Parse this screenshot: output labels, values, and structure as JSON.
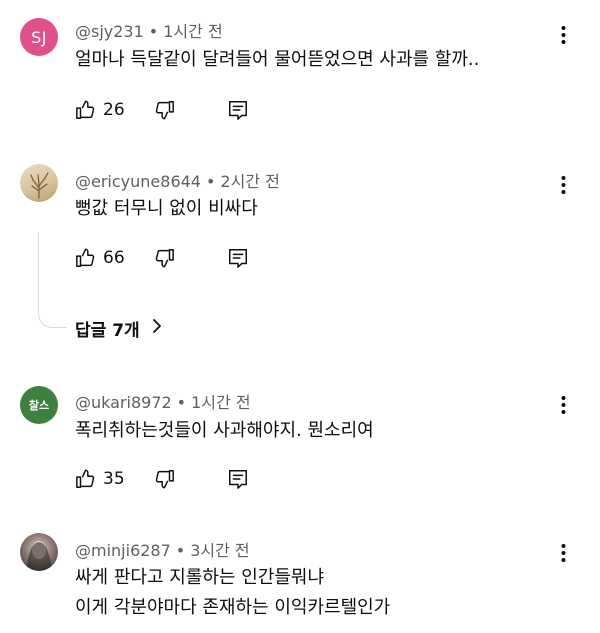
{
  "comments": [
    {
      "avatar_text": "SJ",
      "username": "@sjy231",
      "time": "1시간 전",
      "lines": [
        "얼마나 득달같이 달려들어 물어뜯었으면 사과를 할까.."
      ],
      "likes": "26"
    },
    {
      "avatar_text": "",
      "username": "@ericyune8644",
      "time": "2시간 전",
      "lines": [
        "뻥값 터무니 없이 비싸다"
      ],
      "likes": "66",
      "replies_label": "답글 7개"
    },
    {
      "avatar_text": "찰스",
      "username": "@ukari8972",
      "time": "1시간 전",
      "lines": [
        "폭리취하는것들이 사과해야지. 뭔소리여"
      ],
      "likes": "35"
    },
    {
      "avatar_text": "",
      "username": "@minji6287",
      "time": "3시간 전",
      "lines": [
        "싸게 판다고 지롤하는 인간들뭐냐",
        "이게 각분야마다 존재하는 이익카르텔인가"
      ]
    }
  ],
  "separator": "•",
  "colors": {
    "avatar_sj": "#e0508a",
    "avatar_ukari": "#3f7f3f",
    "meta_text": "#606060",
    "thread_line": "#d9d9d9"
  },
  "icons": [
    "more-vert-icon",
    "thumbs-up-icon",
    "thumbs-down-icon",
    "reply-comment-icon",
    "chevron-right-icon"
  ]
}
